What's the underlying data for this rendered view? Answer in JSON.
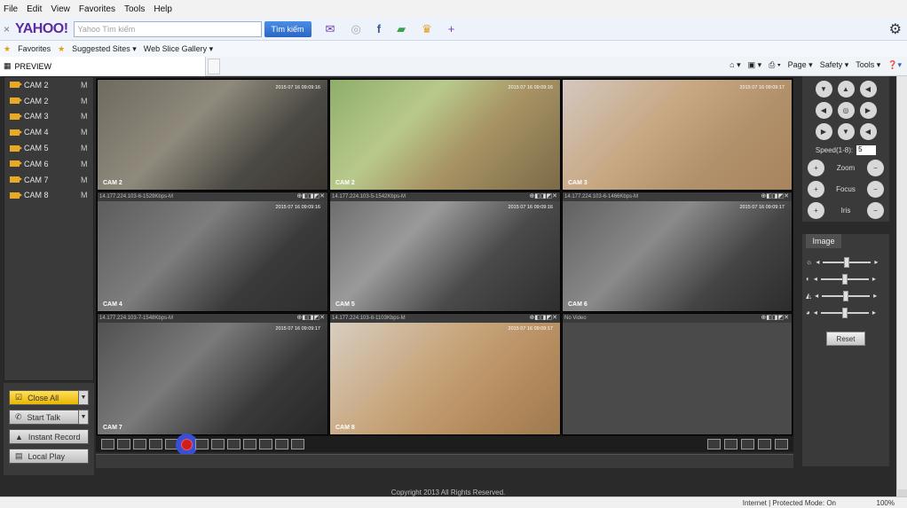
{
  "menu": [
    "File",
    "Edit",
    "View",
    "Favorites",
    "Tools",
    "Help"
  ],
  "yahoo_bar": {
    "logo": "YAHOO!",
    "close": "×",
    "search_placeholder": "Yahoo Tìm kiếm",
    "search_button": "Tìm kiếm"
  },
  "favorites_bar": {
    "favorites": "Favorites",
    "suggested_sites": "Suggested Sites ▾",
    "web_slice": "Web Slice Gallery ▾"
  },
  "tab": {
    "title": "PREVIEW"
  },
  "ie_tools": [
    "Page ▾",
    "Safety ▾",
    "Tools ▾"
  ],
  "channels": [
    {
      "label": "CAM 2",
      "mode": "M"
    },
    {
      "label": "CAM 2",
      "mode": "M"
    },
    {
      "label": "CAM 3",
      "mode": "M"
    },
    {
      "label": "CAM 4",
      "mode": "M"
    },
    {
      "label": "CAM 5",
      "mode": "M"
    },
    {
      "label": "CAM 6",
      "mode": "M"
    },
    {
      "label": "CAM 7",
      "mode": "M"
    },
    {
      "label": "CAM 8",
      "mode": "M"
    }
  ],
  "actions": {
    "close_all": "Close All",
    "start_talk": "Start Talk",
    "instant_record": "Instant Record",
    "local_play": "Local Play"
  },
  "cells": [
    {
      "label": "CAM 2",
      "timestamp": "2015 07 16 09:09:16"
    },
    {
      "label": "CAM 2",
      "timestamp": "2015 07 16 09:09:16"
    },
    {
      "label": "CAM 3",
      "timestamp": "2015 07 16 09:09:17"
    },
    {
      "label": "CAM 4",
      "info": "14.177.224.103-6-1529Kbps-M",
      "timestamp": "2015 07 16 09:09:16"
    },
    {
      "label": "CAM 5",
      "info": "14.177.224.103-5-1542Kbps-M",
      "timestamp": "2015 07 16 09:09:16"
    },
    {
      "label": "CAM 6",
      "info": "14.177.224.103-6-1466Kbps-M",
      "timestamp": "2015 07 16 09:09:17"
    },
    {
      "label": "CAM 7",
      "info": "14.177.224.103-7-1548Kbps-M",
      "timestamp": "2015 07 16 09:09:17"
    },
    {
      "label": "CAM 8",
      "info": "14.177.224.103-8-1103Kbps-M",
      "timestamp": "2015 07 16 09:09:17"
    },
    {
      "label": "",
      "info": "No Video"
    }
  ],
  "ptz": {
    "speed_label": "Speed(1-8):",
    "speed_value": "5",
    "zoom": "Zoom",
    "focus": "Focus",
    "iris": "Iris"
  },
  "image_panel": {
    "tab": "Image",
    "reset": "Reset"
  },
  "footer": {
    "copyright": "Copyright 2013 All Rights Reserved.",
    "zone": "Internet | Protected Mode: On",
    "zoom": "100%"
  }
}
